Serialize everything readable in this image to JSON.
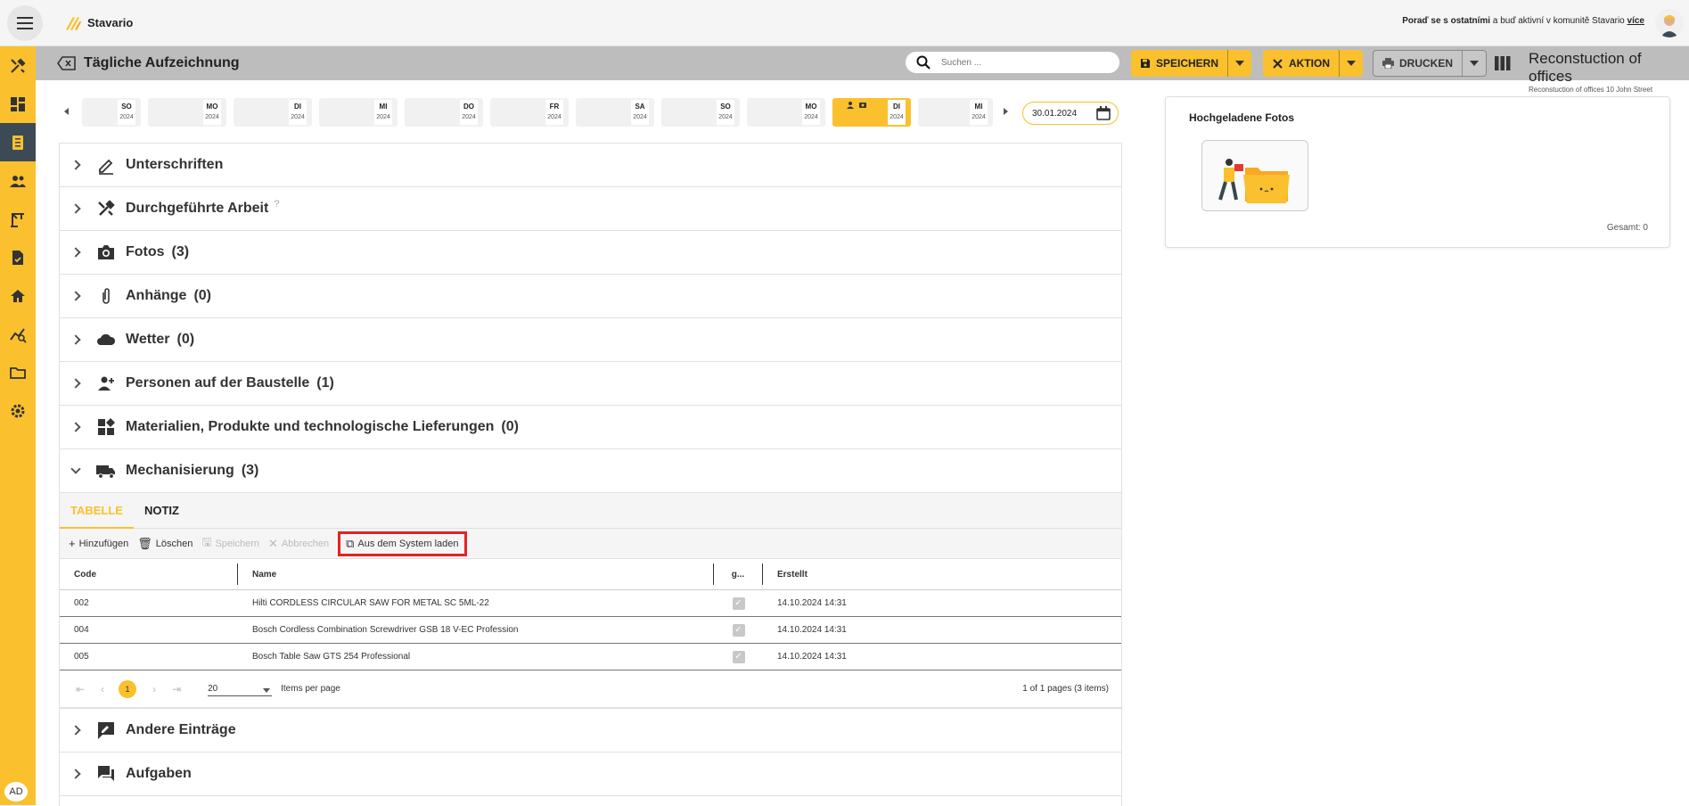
{
  "app": {
    "name": "Stavario"
  },
  "community": {
    "prefix_bold": "Poraď se s ostatními",
    "middle": " a buď aktivní v komunitě Stavario ",
    "link": "více"
  },
  "sidebar": {
    "user_initials": "AD"
  },
  "header": {
    "title": "Tägliche Aufzeichnung",
    "search_placeholder": "Suchen ...",
    "save_label": "SPEICHERN",
    "action_label": "AKTION",
    "print_label": "DRUCKEN",
    "project_name": "Reconstuction of offices",
    "project_sub": "Reconstuction of offices 10 John Street"
  },
  "days": [
    {
      "d": "SO",
      "y": "2024"
    },
    {
      "d": "MO",
      "y": "2024"
    },
    {
      "d": "DI",
      "y": "2024"
    },
    {
      "d": "MI",
      "y": "2024"
    },
    {
      "d": "DO",
      "y": "2024"
    },
    {
      "d": "FR",
      "y": "2024"
    },
    {
      "d": "SA",
      "y": "2024"
    },
    {
      "d": "SO",
      "y": "2024"
    },
    {
      "d": "MO",
      "y": "2024"
    },
    {
      "d": "DI",
      "y": "2024",
      "selected": true
    },
    {
      "d": "MI",
      "y": "2024"
    }
  ],
  "date_value": "30.01.2024",
  "sections": {
    "unterschriften": "Unterschriften",
    "arbeit": "Durchgeführte Arbeit",
    "arbeit_help": "?",
    "fotos": "Fotos",
    "fotos_count": "(3)",
    "anhaenge": "Anhänge",
    "anhaenge_count": "(0)",
    "wetter": "Wetter",
    "wetter_count": "(0)",
    "personen": "Personen auf der Baustelle",
    "personen_count": "(1)",
    "materialien": "Materialien, Produkte und technologische Lieferungen",
    "materialien_count": "(0)",
    "mechanisierung": "Mechanisierung",
    "mechanisierung_count": "(3)",
    "andere": "Andere Einträge",
    "aufgaben": "Aufgaben"
  },
  "mech": {
    "tabs": [
      "TABELLE",
      "NOTIZ"
    ],
    "toolbar": {
      "add": "Hinzufügen",
      "delete": "Löschen",
      "save": "Speichern",
      "cancel": "Abbrechen",
      "load": "Aus dem System laden"
    },
    "columns": [
      "Code",
      "Name",
      "g...",
      "Erstellt"
    ],
    "rows": [
      {
        "code": "002",
        "name": "Hilti CORDLESS CIRCULAR SAW FOR METAL SC 5ML-22",
        "created": "14.10.2024 14:31"
      },
      {
        "code": "004",
        "name": "Bosch Cordless Combination Screwdriver GSB 18 V-EC Profession",
        "created": "14.10.2024 14:31"
      },
      {
        "code": "005",
        "name": "Bosch Table Saw GTS 254 Professional",
        "created": "14.10.2024 14:31"
      }
    ],
    "pager": {
      "page": "1",
      "per_page": "20",
      "per_page_label": "Items per page",
      "info": "1 of 1 pages (3 items)"
    }
  },
  "photos_card": {
    "title": "Hochgeladene Fotos",
    "total": "Gesamt: 0"
  }
}
